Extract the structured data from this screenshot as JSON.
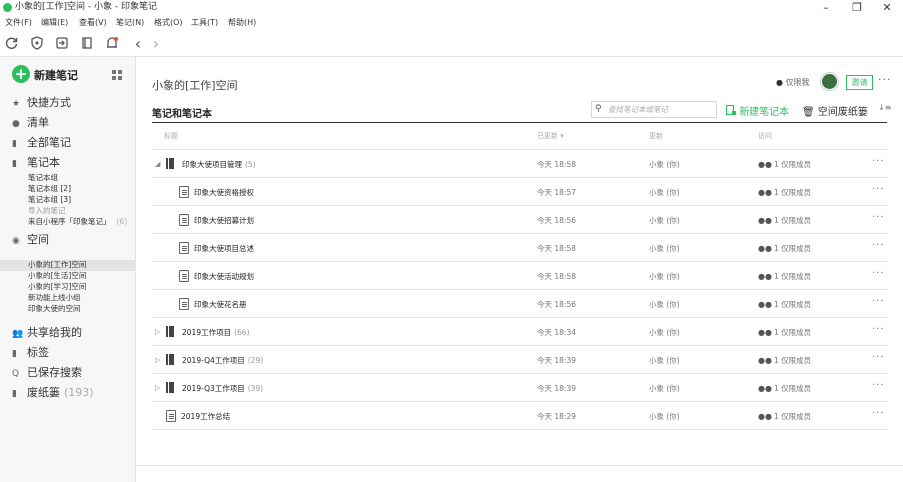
{
  "window": {
    "title": "小象的[工作]空间 - 小象 - 印象笔记",
    "controls": {
      "minimize": "–",
      "maximize": "❐",
      "close": "✕"
    }
  },
  "menu": [
    "文件(F)",
    "编辑(E)",
    "查看(V)",
    "笔记(N)",
    "格式(O)",
    "工具(T)",
    "帮助(H)"
  ],
  "toolbar": {
    "icons": [
      "sync-icon",
      "shield-icon",
      "import-icon",
      "notebook-icon",
      "notification-icon"
    ],
    "back": "‹",
    "forward": "›"
  },
  "sidebar": {
    "new_note": "新建笔记",
    "shortcuts": {
      "icon": "★",
      "label": "快捷方式"
    },
    "checklist": {
      "icon": "●",
      "label": "清单"
    },
    "all_notes": {
      "icon": "▮",
      "label": "全部笔记"
    },
    "notebooks": {
      "icon": "▮",
      "label": "笔记本",
      "items": [
        {
          "label": "笔记本组",
          "count": ""
        },
        {
          "label": "笔记本组 [2]",
          "count": ""
        },
        {
          "label": "笔记本组 [3]",
          "count": ""
        },
        {
          "label": "导入的笔记",
          "count": ""
        },
        {
          "label": "来自小程序「印象笔记」",
          "count": "(6)"
        }
      ]
    },
    "spaces": {
      "icon": "◉",
      "label": "空间",
      "items": [
        {
          "label": "小象的[工作]空间"
        },
        {
          "label": "小象的[生活]空间"
        },
        {
          "label": "小象的[学习]空间"
        },
        {
          "label": "新功能上线小组"
        },
        {
          "label": "印象大使的空间"
        }
      ]
    },
    "shared": {
      "icon": "👥",
      "label": "共享给我的"
    },
    "tags": {
      "icon": "▮",
      "label": "标签"
    },
    "saved_search": {
      "icon": "Q",
      "label": "已保存搜索"
    },
    "trash": {
      "icon": "▮",
      "label": "废纸篓",
      "count": "(193)"
    }
  },
  "main": {
    "space_title": "小象的[工作]空间",
    "members_only": "仅限我",
    "invite": "邀请",
    "more": "···",
    "section_title": "笔记和笔记本",
    "search_placeholder": "查找笔记本或笔记",
    "search_icon": "⚲",
    "new_notebook": "新建笔记本",
    "space_trash": "空间废纸篓",
    "sort_icon": "↓≡",
    "columns": {
      "title": "标题",
      "updated": "已更新 ▾",
      "by": "更新",
      "access": "访问"
    },
    "rows": [
      {
        "type": "notebook",
        "expanded": true,
        "name": "印象大使项目管理",
        "count": "(5)",
        "updated": "今天 18:58",
        "by": "小象 (你)",
        "access": "1 仅限成员"
      },
      {
        "type": "note",
        "name": "印象大使资格授权",
        "count": "",
        "updated": "今天 18:57",
        "by": "小象 (你)",
        "access": "1 仅限成员"
      },
      {
        "type": "note",
        "name": "印象大使招募计划",
        "count": "",
        "updated": "今天 18:56",
        "by": "小象 (你)",
        "access": "1 仅限成员"
      },
      {
        "type": "note",
        "name": "印象大使项目总述",
        "count": "",
        "updated": "今天 18:58",
        "by": "小象 (你)",
        "access": "1 仅限成员"
      },
      {
        "type": "note",
        "name": "印象大使活动规划",
        "count": "",
        "updated": "今天 18:58",
        "by": "小象 (你)",
        "access": "1 仅限成员"
      },
      {
        "type": "note",
        "name": "印象大使花名册",
        "count": "",
        "updated": "今天 18:56",
        "by": "小象 (你)",
        "access": "1 仅限成员"
      },
      {
        "type": "notebook",
        "expanded": false,
        "name": "2019工作项目",
        "count": "(66)",
        "updated": "今天 18:34",
        "by": "小象 (你)",
        "access": "1 仅限成员"
      },
      {
        "type": "notebook",
        "expanded": false,
        "name": "2019-Q4工作项目",
        "count": "(29)",
        "updated": "今天 18:39",
        "by": "小象 (你)",
        "access": "1 仅限成员"
      },
      {
        "type": "notebook",
        "expanded": false,
        "name": "2019-Q3工作项目",
        "count": "(39)",
        "updated": "今天 18:39",
        "by": "小象 (你)",
        "access": "1 仅限成员"
      },
      {
        "type": "note-top",
        "name": "2019工作总结",
        "count": "",
        "updated": "今天 18:29",
        "by": "小象 (你)",
        "access": "1 仅限成员"
      }
    ]
  },
  "colors": {
    "accent": "#2dbe60",
    "selected": "#e3e3e3",
    "sidebar_bg": "#f7f7f7"
  }
}
